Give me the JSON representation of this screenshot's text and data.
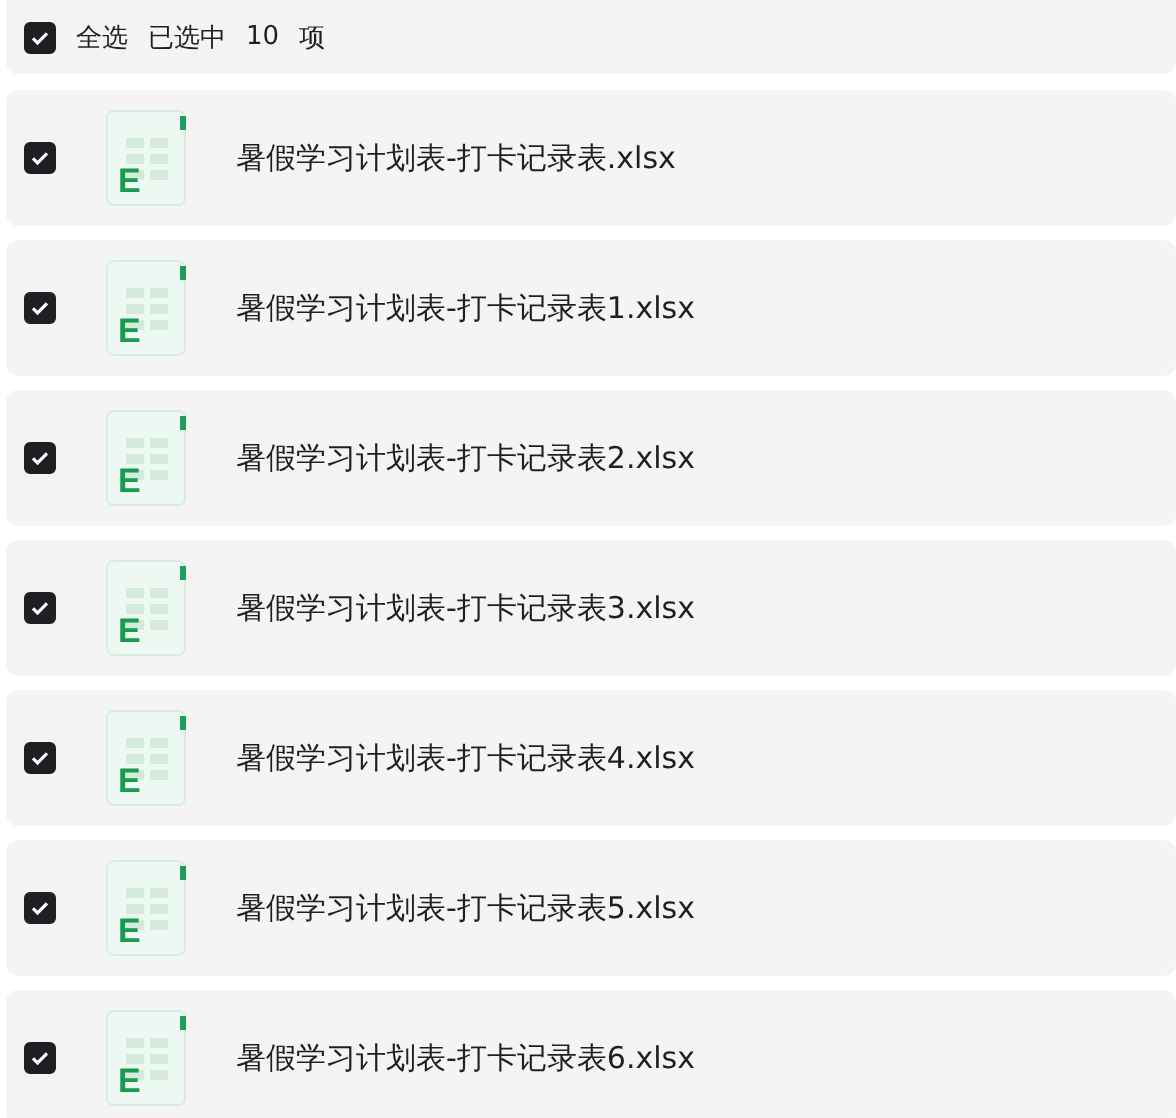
{
  "header": {
    "checked": true,
    "select_all": "全选",
    "selected_text": "已选中",
    "count": "10",
    "unit": "项"
  },
  "files": [
    {
      "name": "暑假学习计划表-打卡记录表.xlsx",
      "icon_letter": "E",
      "checked": true
    },
    {
      "name": "暑假学习计划表-打卡记录表1.xlsx",
      "icon_letter": "E",
      "checked": true
    },
    {
      "name": "暑假学习计划表-打卡记录表2.xlsx",
      "icon_letter": "E",
      "checked": true
    },
    {
      "name": "暑假学习计划表-打卡记录表3.xlsx",
      "icon_letter": "E",
      "checked": true
    },
    {
      "name": "暑假学习计划表-打卡记录表4.xlsx",
      "icon_letter": "E",
      "checked": true
    },
    {
      "name": "暑假学习计划表-打卡记录表5.xlsx",
      "icon_letter": "E",
      "checked": true
    },
    {
      "name": "暑假学习计划表-打卡记录表6.xlsx",
      "icon_letter": "E",
      "checked": true
    }
  ]
}
